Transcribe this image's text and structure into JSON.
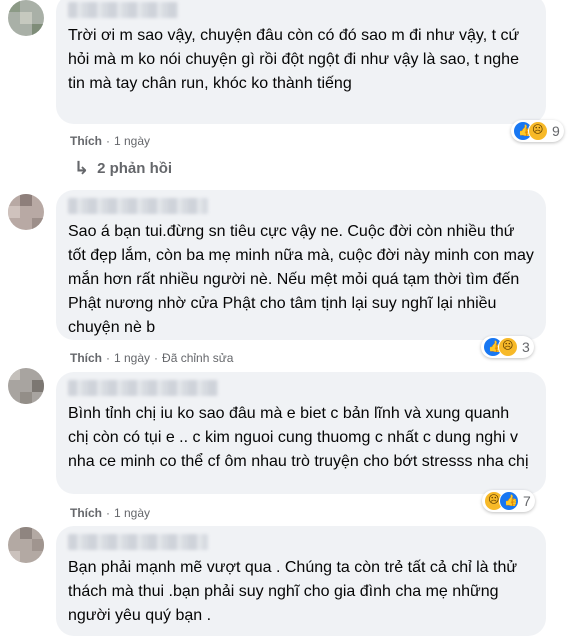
{
  "comments": [
    {
      "text": "Trời ơi m sao vậy, chuyện đâu còn có đó sao m đi như vậy, t cứ hỏi mà m ko nói chuyện gì rồi đột ngột đi như vậy là sao, t nghe tin mà tay chân run, khóc ko thành tiếng",
      "like_label": "Thích",
      "time": "1 ngày",
      "edited": "",
      "reaction_count": "9",
      "reactions": [
        "like-icon",
        "sad-icon"
      ]
    },
    {
      "text": "Sao á bạn tui.đừng sn tiêu cực vậy ne. Cuộc đời còn nhiều thứ tốt đẹp lắm, còn ba mẹ minh nữa mà, cuộc đời này minh con may mắn hơn rất nhiều người nè. Nếu mệt mỏi quá tạm thời tìm đến Phật nương nhờ cửa Phật cho tâm tịnh lại suy nghĩ lại nhiều chuyện nè b",
      "like_label": "Thích",
      "time": "1 ngày",
      "edited": "Đã chỉnh sửa",
      "reaction_count": "3",
      "reactions": [
        "like-icon",
        "sad-icon"
      ]
    },
    {
      "text": "Bình tỉnh chị iu ko sao đâu mà e biet c bản lĩnh và xung quanh chị còn có tụi e .. c kim nguoi cung thuomg c nhất c dung nghi v nha ce minh co thể cf ôm nhau trò truyện cho bớt stresss nha chị",
      "like_label": "Thích",
      "time": "1 ngày",
      "edited": "",
      "reaction_count": "7",
      "reactions": [
        "sad-icon",
        "like-icon"
      ]
    },
    {
      "text": "Bạn phải mạnh mẽ vượt qua . Chúng ta còn trẻ tất cả chỉ là thử thách mà thui .bạn phải suy nghĩ cho gia đình cha mẹ những người yêu quý bạn .",
      "like_label": "Thích",
      "time": "",
      "edited": "",
      "reaction_count": "",
      "reactions": []
    }
  ],
  "replies_label": "2 phản hồi",
  "colors": {
    "bubble": "#f0f2f5",
    "meta": "#65676b",
    "like": "#1877f2",
    "sad": "#f7b928"
  }
}
